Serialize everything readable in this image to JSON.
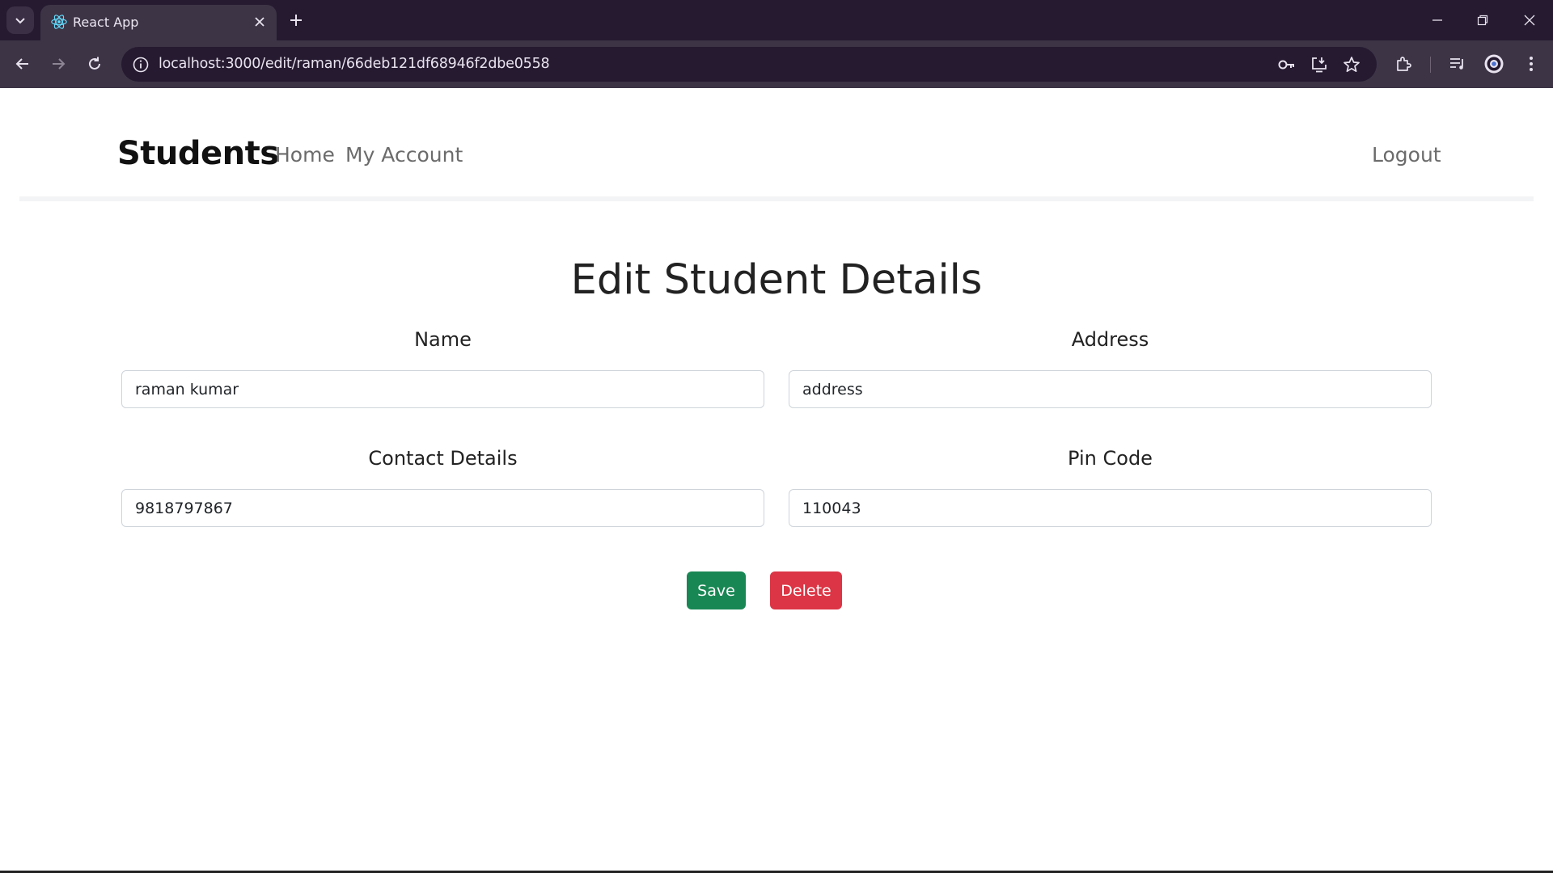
{
  "browser": {
    "tab_title": "React App",
    "url": "localhost:3000/edit/raman/66deb121df68946f2dbe0558"
  },
  "navbar": {
    "brand": "Students",
    "links": [
      "Home",
      "My Account"
    ],
    "logout": "Logout"
  },
  "main": {
    "title": "Edit Student Details",
    "fields": [
      {
        "label": "Name",
        "value": "raman kumar"
      },
      {
        "label": "Address",
        "value": "address"
      },
      {
        "label": "Contact Details",
        "value": "9818797867"
      },
      {
        "label": "Pin Code",
        "value": "110043"
      }
    ],
    "save_label": "Save",
    "delete_label": "Delete"
  },
  "colors": {
    "save": "#198754",
    "delete": "#dc3545",
    "chrome_dark": "#251a30",
    "chrome_mid": "#3d3446"
  },
  "icons": [
    "tab-list-icon",
    "react-favicon-icon",
    "close-icon",
    "plus-icon",
    "minimize-icon",
    "restore-icon",
    "window-close-icon",
    "back-arrow-icon",
    "forward-arrow-icon",
    "reload-icon",
    "site-info-icon",
    "key-icon",
    "install-app-icon",
    "star-icon",
    "extensions-icon",
    "media-control-icon",
    "profile-icon",
    "more-vert-icon"
  ]
}
